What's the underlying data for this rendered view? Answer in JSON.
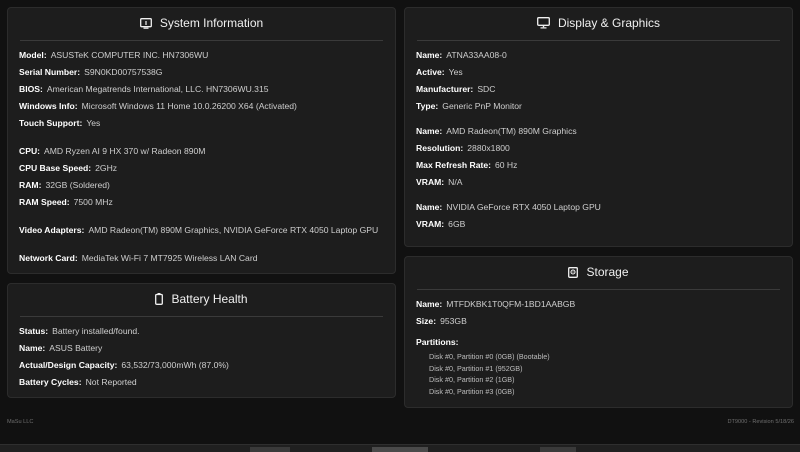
{
  "system": {
    "title": "System Information",
    "icon": "monitor-info-icon",
    "rows": [
      {
        "k": "Model:",
        "v": "ASUSTeK COMPUTER INC. HN7306WU"
      },
      {
        "k": "Serial Number:",
        "v": "S9N0KD00757538G"
      },
      {
        "k": "BIOS:",
        "v": "American Megatrends International, LLC. HN7306WU.315"
      },
      {
        "k": "Windows Info:",
        "v": "Microsoft Windows 11 Home 10.0.26200 X64 (Activated)"
      },
      {
        "k": "Touch Support:",
        "v": "Yes"
      },
      {
        "k": "CPU:",
        "v": "AMD Ryzen AI 9 HX 370 w/ Radeon 890M"
      },
      {
        "k": "CPU Base Speed:",
        "v": "2GHz"
      },
      {
        "k": "RAM:",
        "v": "32GB (Soldered)"
      },
      {
        "k": "RAM Speed:",
        "v": "7500 MHz"
      },
      {
        "k": "Video Adapters:",
        "v": "AMD Radeon(TM) 890M Graphics, NVIDIA GeForce RTX 4050 Laptop GPU"
      },
      {
        "k": "Network Card:",
        "v": "MediaTek Wi-Fi 7 MT7925 Wireless LAN Card"
      }
    ]
  },
  "battery": {
    "title": "Battery Health",
    "icon": "battery-icon",
    "rows": [
      {
        "k": "Status:",
        "v": "Battery installed/found."
      },
      {
        "k": "Name:",
        "v": "ASUS Battery"
      },
      {
        "k": "Actual/Design Capacity:",
        "v": "63,532/73,000mWh (87.0%)"
      },
      {
        "k": "Battery Cycles:",
        "v": "Not Reported"
      }
    ]
  },
  "display": {
    "title": "Display & Graphics",
    "icon": "desktop-monitor-icon",
    "rows": [
      {
        "k": "Name:",
        "v": "ATNA33AA08-0"
      },
      {
        "k": "Active:",
        "v": "Yes"
      },
      {
        "k": "Manufacturer:",
        "v": "SDC"
      },
      {
        "k": "Type:",
        "v": "Generic PnP Monitor"
      },
      {
        "k": "Name:",
        "v": "AMD Radeon(TM) 890M Graphics"
      },
      {
        "k": "Resolution:",
        "v": "2880x1800"
      },
      {
        "k": "Max Refresh Rate:",
        "v": "60 Hz"
      },
      {
        "k": "VRAM:",
        "v": "N/A"
      },
      {
        "k": "Name:",
        "v": "NVIDIA GeForce RTX 4050 Laptop GPU"
      },
      {
        "k": "VRAM:",
        "v": "6GB"
      }
    ]
  },
  "storage": {
    "title": "Storage",
    "icon": "hard-drive-icon",
    "rows": [
      {
        "k": "Name:",
        "v": "MTFDKBK1T0QFM-1BD1AABGB"
      },
      {
        "k": "Size:",
        "v": "953GB"
      },
      {
        "k": "Partitions:",
        "v": ""
      }
    ],
    "partitions": [
      "Disk #0, Partition #0 (0GB) (Bootable)",
      "Disk #0, Partition #1 (952GB)",
      "Disk #0, Partition #2 (1GB)",
      "Disk #0, Partition #3 (0GB)"
    ]
  },
  "footer": {
    "left": "MaSu LLC",
    "right": "DT9000 - Revision 5/18/26"
  }
}
